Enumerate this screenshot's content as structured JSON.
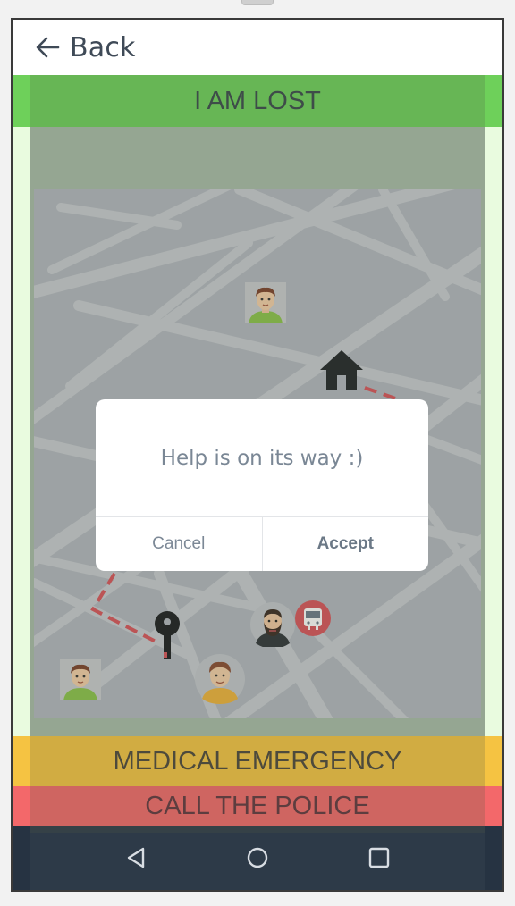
{
  "header": {
    "back_label": "Back"
  },
  "buttons": {
    "lost": "I AM LOST",
    "medical": "MEDICAL EMERGENCY",
    "police": "CALL THE POLICE"
  },
  "dialog": {
    "message": "Help is on its way :)",
    "cancel_label": "Cancel",
    "accept_label": "Accept"
  },
  "map_icons": [
    "person-avatar-icon",
    "home-icon",
    "key-icon",
    "bearded-man-avatar-icon",
    "train-icon"
  ],
  "navbar": {
    "icons": [
      "back-triangle-icon",
      "home-circle-icon",
      "recents-square-icon"
    ]
  },
  "colors": {
    "lost": "#6ed05a",
    "medical": "#f5c342",
    "police": "#f3686a",
    "navbar": "#2d3a48",
    "map": "#b3b7bf"
  }
}
